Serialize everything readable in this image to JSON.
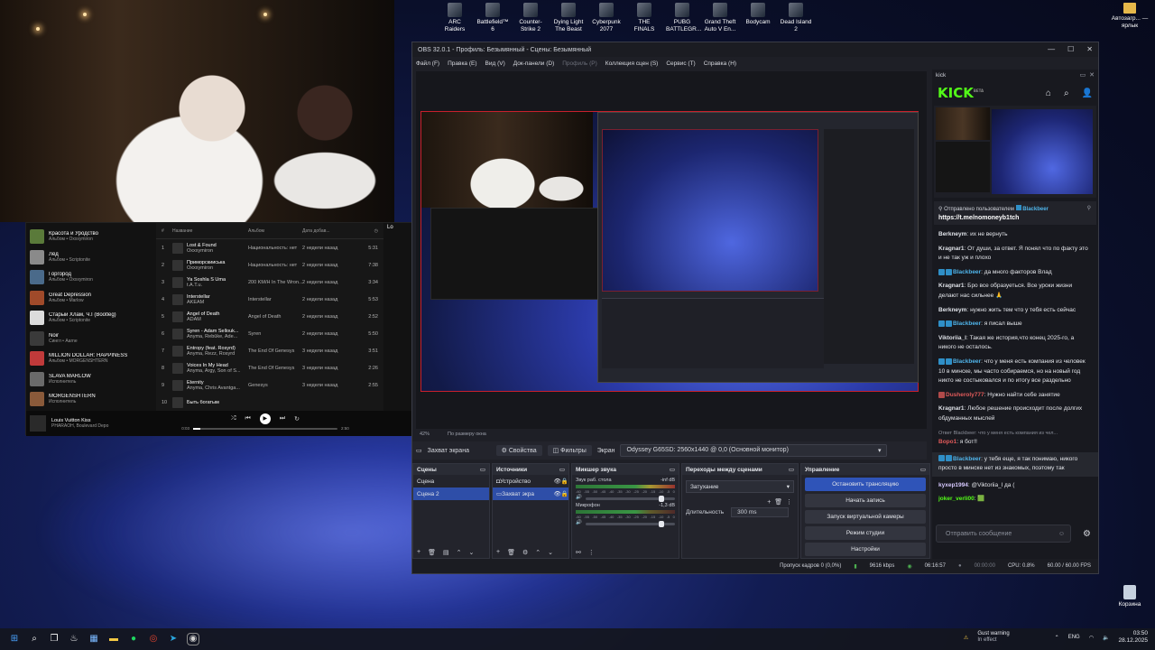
{
  "desktop": {
    "icons": [
      "ARC Raiders",
      "Battlefield™ 6",
      "Counter-Strike 2",
      "Dying Light The Beast",
      "Cyberpunk 2077",
      "THE FINALS",
      "PUBG BATTLEGR...",
      "Grand Theft Auto V En...",
      "Bodycam",
      "Dead Island 2"
    ],
    "shortcut_right": "Автозагр... — ярлык",
    "recycle_bin": "Корзина"
  },
  "spotify": {
    "library": [
      {
        "title": "Красота и Уродство",
        "sub": "Альбом • Oxxxymiron",
        "color": "#5a7a3a"
      },
      {
        "title": "Лёд",
        "sub": "Альбом • Scriptonite",
        "color": "#8a8a8a"
      },
      {
        "title": "Горгород",
        "sub": "Альбом • Oxxxymiron",
        "color": "#4a6a8a"
      },
      {
        "title": "Great Depression",
        "sub": "Альбом • Marlow",
        "color": "#a04a2a"
      },
      {
        "title": "Старый Хлам, Ч.I (Bootleg)",
        "sub": "Альбом • Scriptonite",
        "color": "#dcdcdc"
      },
      {
        "title": "Noir",
        "sub": "Сингл • Aarne",
        "color": "#3a3a3a"
      },
      {
        "title": "MILLION DOLLAR: HAPPINESS",
        "sub": "Альбом • MORGENSHTERN",
        "color": "#c03a3a"
      },
      {
        "title": "SLAVA MARLOW",
        "sub": "Исполнитель",
        "color": "#6a6a6a"
      },
      {
        "title": "MORGENSHTERN",
        "sub": "Исполнитель",
        "color": "#8a5a3a"
      }
    ],
    "columns": {
      "num": "#",
      "title": "Название",
      "album": "Альбом",
      "added": "Дата добав...",
      "dur": "◷"
    },
    "tracks": [
      {
        "n": "1",
        "title": "Lost & Found",
        "artist": "Oxxxymiron",
        "album": "Национальность: нет",
        "added": "2 недели назад",
        "dur": "5:31"
      },
      {
        "n": "2",
        "title": "Приморскииська",
        "artist": "Oxxxymiron",
        "album": "Национальность: нет",
        "added": "2 недели назад",
        "dur": "7:38"
      },
      {
        "n": "3",
        "title": "Ya Soshla S Uma",
        "artist": "t.A.T.u.",
        "album": "200 KM/H In The Wron...",
        "added": "2 недели назад",
        "dur": "3:34"
      },
      {
        "n": "4",
        "title": "Interstellar",
        "artist": "AKEAM",
        "album": "Interstellar",
        "added": "2 недели назад",
        "dur": "5:53"
      },
      {
        "n": "5",
        "title": "Angel of Death",
        "artist": "ADAM",
        "album": "Angel of Death",
        "added": "2 недели назад",
        "dur": "2:52"
      },
      {
        "n": "6",
        "title": "Syren - Adam Sellouk...",
        "artist": "Anyma, Rebūke, Ade...",
        "album": "Syren",
        "added": "2 недели назад",
        "dur": "5:50"
      },
      {
        "n": "7",
        "title": "Entropy (feat. Rosyrd)",
        "artist": "Anyma, Rezz, Rosyrd",
        "album": "The End Of Genesys",
        "added": "3 недели назад",
        "dur": "3:51"
      },
      {
        "n": "8",
        "title": "Voices In My Head",
        "artist": "Anyma, Argy, Son of S...",
        "album": "The End Of Genesys",
        "added": "3 недели назад",
        "dur": "2:26"
      },
      {
        "n": "9",
        "title": "Eternity",
        "artist": "Anyma, Chris Avantga...",
        "album": "Genesys",
        "added": "3 недели назад",
        "dur": "2:55"
      },
      {
        "n": "10",
        "title": "Быть богатым",
        "artist": "",
        "album": "",
        "added": "",
        "dur": ""
      }
    ],
    "right_panel": "Lo",
    "now_playing": {
      "title": "Louis Vuitton Kiss",
      "artist": "PHARAOH, Boulevard Depo",
      "elapsed": "0:03",
      "total": "2:50",
      "progress": 0.05
    }
  },
  "obs": {
    "title": "OBS 32.0.1 - Профиль: Безымянный - Сцены: Безымянный",
    "window_controls": [
      "—",
      "☐",
      "✕"
    ],
    "menu": [
      {
        "label": "Файл (F)",
        "dim": false
      },
      {
        "label": "Правка (E)",
        "dim": false
      },
      {
        "label": "Вид (V)",
        "dim": false
      },
      {
        "label": "Док-панели (D)",
        "dim": false
      },
      {
        "label": "Профиль (P)",
        "dim": true
      },
      {
        "label": "Коллекция сцен (S)",
        "dim": false
      },
      {
        "label": "Сервис (T)",
        "dim": false
      },
      {
        "label": "Справка (H)",
        "dim": false
      }
    ],
    "zoom": "42%",
    "zoom_mode": "По размеру окна",
    "source_bar": {
      "source": "Захват экрана",
      "properties": "Свойства",
      "filters": "Фильтры",
      "screen_label": "Экран",
      "screen_value": "Odyssey G65SD: 2560x1440 @ 0,0 (Основной монитор)"
    },
    "scenes": {
      "title": "Сцены",
      "items": [
        "Сцена",
        "Сцена 2"
      ],
      "selected": 1
    },
    "sources": {
      "title": "Источники",
      "items": [
        "Устройство",
        "Захват экра"
      ],
      "selected": 1
    },
    "mixer": {
      "title": "Микшер звука",
      "channels": [
        {
          "name": "Звук раб. стола",
          "level": "-inf dB"
        },
        {
          "name": "Микрофон",
          "level": "-1,3 dB"
        }
      ],
      "ticks": [
        "-60",
        "-55",
        "-50",
        "-45",
        "-40",
        "-35",
        "-30",
        "-25",
        "-20",
        "-15",
        "-10",
        "-5",
        "0"
      ]
    },
    "transitions": {
      "title": "Переходы между сценами",
      "type": "Затухание",
      "duration_label": "Длительность",
      "duration": "300 ms"
    },
    "controls": {
      "title": "Управление",
      "buttons": [
        "Остановить трансляцию",
        "Начать запись",
        "Запуск виртуальной камеры",
        "Режим студии",
        "Настройки"
      ]
    },
    "status": {
      "dropped": "Пропуск кадров 0 (0,0%)",
      "bitrate": "9616 kbps",
      "stream_time": "06:16:57",
      "rec_time": "00:00:00",
      "cpu": "CPU: 0.8%",
      "fps": "60.00 / 60.00 FPS"
    }
  },
  "kick": {
    "dock_title": "kick",
    "logo": "KICK",
    "logo_tag": "BETA",
    "pinned": {
      "by": "Отправлено пользователем",
      "user": "Blackbeer",
      "link": "https://t.me/nomoneyb1tch"
    },
    "messages": [
      {
        "user": "Berkneym",
        "color": "#dfe2e8",
        "badges": 0,
        "text": "их не вернуть"
      },
      {
        "user": "Kragnar1",
        "color": "#dfe2e8",
        "badges": 0,
        "text": "От души, за ответ. Я понял что по факту это и не так уж и плохо"
      },
      {
        "user": "Blackbeer",
        "color": "#4fb3e8",
        "badges": 2,
        "text": "да много факторов Влад"
      },
      {
        "user": "Kragnar1",
        "color": "#dfe2e8",
        "badges": 0,
        "text": "Бро все образуеться. Все уроки жизни делают нас сильнее 🙏"
      },
      {
        "user": "Berkneym",
        "color": "#dfe2e8",
        "badges": 0,
        "text": "нужно жить тем что у тебя есть сейчас"
      },
      {
        "user": "Blackbeer",
        "color": "#4fb3e8",
        "badges": 2,
        "text": "я писал выше"
      },
      {
        "user": "Viktoriia_l",
        "color": "#dfe2e8",
        "badges": 0,
        "text": "Такая же история,что конец 2025-го, а никого не осталось."
      },
      {
        "user": "Blackbeer",
        "color": "#4fb3e8",
        "badges": 2,
        "text": "что у меня есть компания из человек 10 в минске, мы часто собираемся, но на новый год никто не состыковался и по итогу все раздельно"
      },
      {
        "user": "Dusheroly777",
        "color": "#e05a5a",
        "badges": 1,
        "text": "Нужно найти себе занятие"
      },
      {
        "user": "Kragnar1",
        "color": "#dfe2e8",
        "badges": 0,
        "text": "Любое решение происходит после долгих обдуманных мыслей"
      },
      {
        "reply": "Ответ Blackbeer: что у меня есть компания из чел...",
        "user": "Bopo1",
        "color": "#e05a5a",
        "badges": 0,
        "text": "я бот!!"
      },
      {
        "user": "Blackbeer",
        "color": "#4fb3e8",
        "badges": 2,
        "text": "у тебя еще, я так понимаю, никого просто в минске нет из знакомых, поэтому так",
        "highlight": true
      },
      {
        "user": "kyxep1994",
        "color": "#d7c9ff",
        "badges": 0,
        "text": "@Viktoriia_l да ("
      },
      {
        "user": "joker_verli00",
        "color": "#53fc18",
        "badges": 0,
        "text": "🟩"
      }
    ],
    "input_placeholder": "Отправить сообщение"
  },
  "taskbar": {
    "warning_title": "Gust warning",
    "warning_sub": "In effect",
    "lang": "ENG",
    "time": "03:50",
    "date": "28.12.2025"
  }
}
